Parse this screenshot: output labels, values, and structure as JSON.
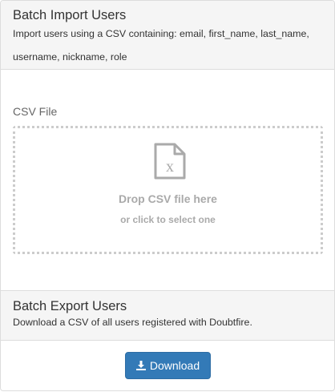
{
  "import": {
    "title": "Batch Import Users",
    "description": "Import users using a CSV containing: email, first_name, last_name, username, nickname, role",
    "field_label": "CSV File",
    "dropzone": {
      "main_text": "Drop CSV file here",
      "sub_text": "or click to select one",
      "icon": "csv-file-icon"
    }
  },
  "export": {
    "title": "Batch Export Users",
    "description": "Download a CSV of all users registered with Doubtfire.",
    "button_label": "Download",
    "button_icon": "download-icon"
  },
  "colors": {
    "header_bg": "#f5f5f5",
    "primary_button": "#337ab7",
    "dropzone_text": "#aaaaaa",
    "border": "#dddddd"
  }
}
